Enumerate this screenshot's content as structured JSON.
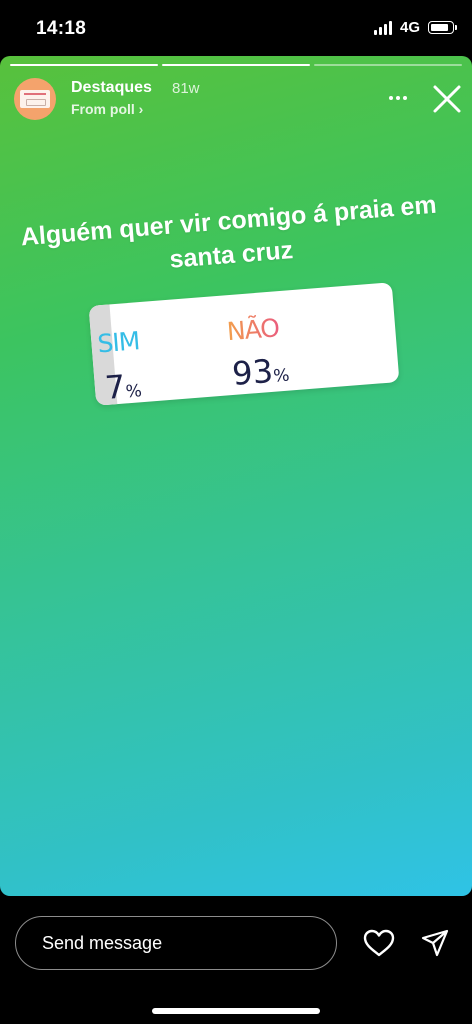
{
  "status_bar": {
    "time": "14:18",
    "network": "4G"
  },
  "story": {
    "progress_segments": 3,
    "progress_done": 2,
    "user_name": "Destaques",
    "age": "81w",
    "from_label": "From poll ›",
    "question": "Alguém quer vir comigo á praia em santa cruz",
    "poll": {
      "option_yes": {
        "label": "SIM",
        "percent": "7",
        "fraction": 0.07,
        "color": "#35bde6"
      },
      "option_no": {
        "label": "NÃO",
        "percent": "93",
        "fraction": 0.93,
        "colors": [
          "#f2a04c",
          "#ea5d7d"
        ]
      },
      "percent_sign": "%"
    }
  },
  "footer": {
    "message_placeholder": "Send message"
  },
  "icons": [
    "signal-icon",
    "battery-icon",
    "more-icon",
    "close-icon",
    "heart-icon",
    "send-icon"
  ]
}
